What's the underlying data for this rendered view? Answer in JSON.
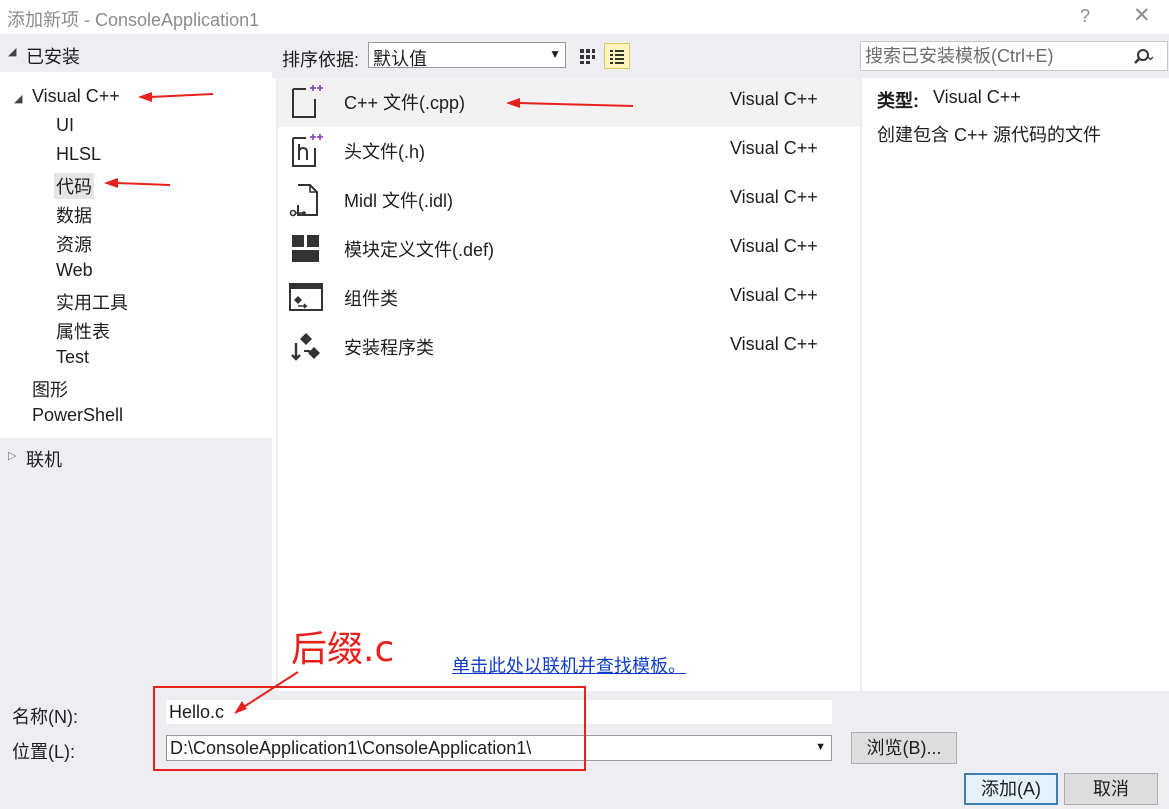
{
  "window": {
    "title": "添加新项 - ConsoleApplication1",
    "help": "?",
    "close": "✕"
  },
  "tree": {
    "installed_label": "已安装",
    "items": [
      {
        "label": "Visual C++"
      },
      {
        "label": "UI"
      },
      {
        "label": "HLSL"
      },
      {
        "label": "代码"
      },
      {
        "label": "数据"
      },
      {
        "label": "资源"
      },
      {
        "label": "Web"
      },
      {
        "label": "实用工具"
      },
      {
        "label": "属性表"
      },
      {
        "label": "Test"
      },
      {
        "label": "图形"
      },
      {
        "label": "PowerShell"
      }
    ],
    "online_label": "联机"
  },
  "toolbar": {
    "sort_label": "排序依据:",
    "sort_value": "默认值",
    "search_placeholder": "搜索已安装模板(Ctrl+E)"
  },
  "templates": [
    {
      "name": "C++ 文件(.cpp)",
      "lang": "Visual C++",
      "icon": "cpp-file-icon"
    },
    {
      "name": "头文件(.h)",
      "lang": "Visual C++",
      "icon": "header-file-icon"
    },
    {
      "name": "Midl 文件(.idl)",
      "lang": "Visual C++",
      "icon": "idl-file-icon"
    },
    {
      "name": "模块定义文件(.def)",
      "lang": "Visual C++",
      "icon": "def-file-icon"
    },
    {
      "name": "组件类",
      "lang": "Visual C++",
      "icon": "component-class-icon"
    },
    {
      "name": "安装程序类",
      "lang": "Visual C++",
      "icon": "installer-class-icon"
    }
  ],
  "online_link": "单击此处以联机并查找模板。",
  "details": {
    "type_label": "类型:",
    "type_value": "Visual C++",
    "description": "创建包含 C++ 源代码的文件"
  },
  "form": {
    "name_label": "名称(N):",
    "name_value": "Hello.c",
    "location_label": "位置(L):",
    "location_value": "D:\\ConsoleApplication1\\ConsoleApplication1\\",
    "browse_label": "浏览(B)...",
    "add_label": "添加(A)",
    "cancel_label": "取消"
  },
  "annotation": {
    "text": "后缀.c",
    "color": "#e8201c"
  },
  "colors": {
    "panel_bg": "#eeeef2",
    "selected_row": "#f2f2f2",
    "link": "#0e3ec8"
  }
}
